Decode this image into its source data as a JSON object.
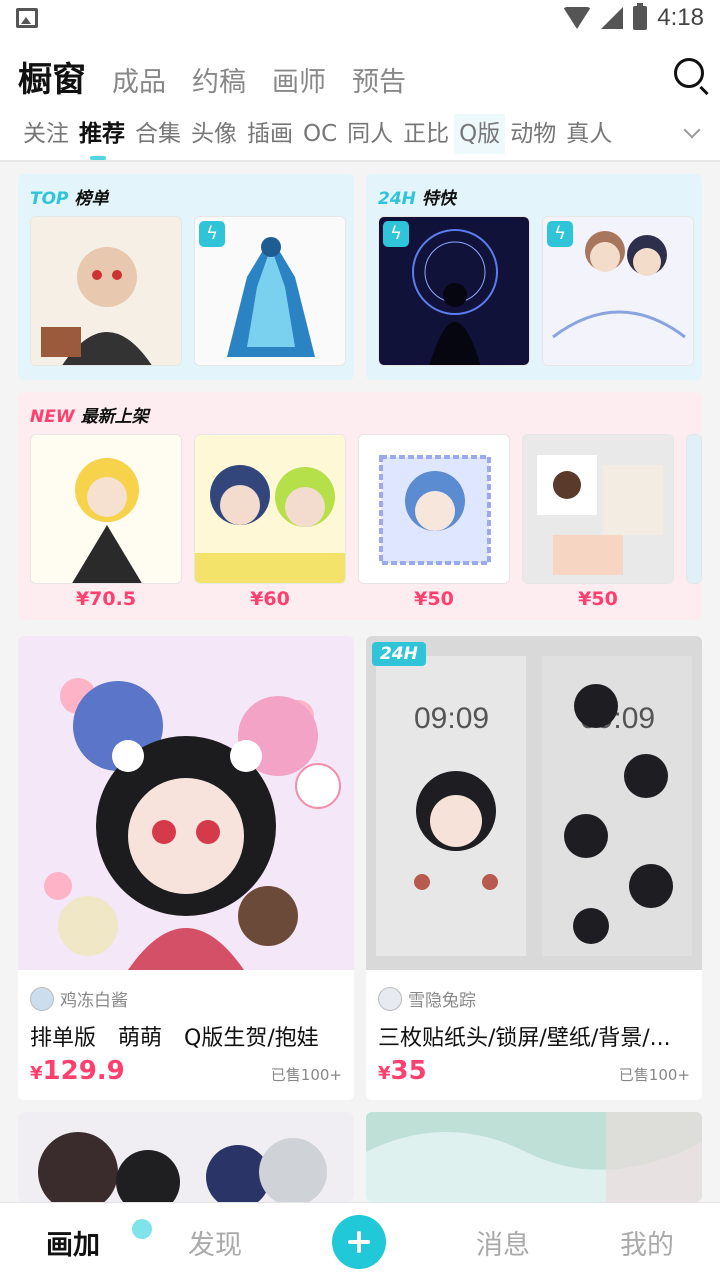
{
  "status_bar": {
    "time": "4:18"
  },
  "header": {
    "main_tabs": [
      "橱窗",
      "成品",
      "约稿",
      "画师",
      "预告"
    ],
    "sub_tabs": [
      "关注",
      "推荐",
      "合集",
      "头像",
      "插画",
      "OC",
      "同人",
      "正比",
      "Q版",
      "动物",
      "真人"
    ]
  },
  "panels": {
    "top": {
      "tag": "TOP",
      "label": "榜单"
    },
    "h24": {
      "tag": "24H",
      "label": "特快"
    },
    "new": {
      "tag": "NEW",
      "label": "最新上架",
      "prices": [
        "¥70.5",
        "¥60",
        "¥50",
        "¥50"
      ]
    }
  },
  "cards": [
    {
      "artist": "鸡冻白酱",
      "title": "排单版　萌萌　Q版生贺/抱娃",
      "currency": "¥",
      "price": "129.9",
      "sold": "已售100+"
    },
    {
      "artist": "雪隐兔踪",
      "title": "三枚贴纸头/锁屏/壁纸/背景/...",
      "currency": "¥",
      "price": "35",
      "sold": "已售100+",
      "badge": "24H"
    }
  ],
  "bottom_nav": [
    "画加",
    "发现",
    "消息",
    "我的"
  ],
  "colors": {
    "accent": "#20c8d8",
    "price": "#ff3f6e",
    "panel_blue": "#e3f5fa",
    "panel_pink": "#fdecf0"
  }
}
